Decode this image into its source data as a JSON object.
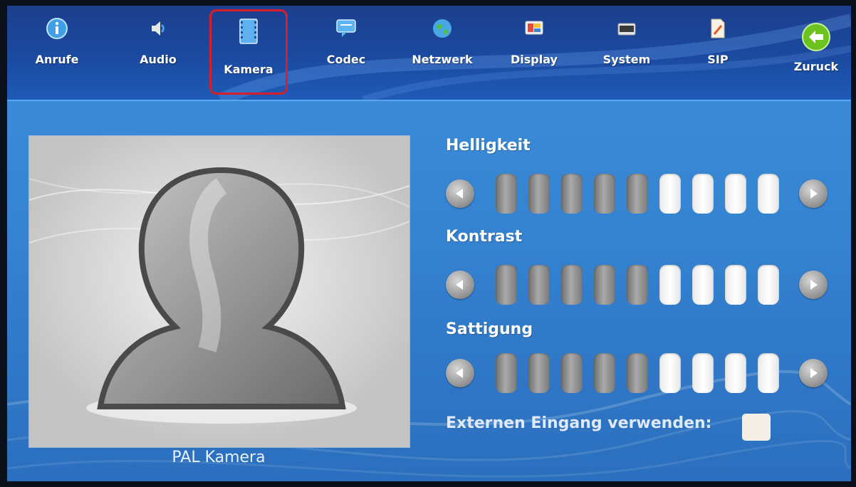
{
  "nav": {
    "items": [
      {
        "label": "Anrufe",
        "icon": "info-icon"
      },
      {
        "label": "Audio",
        "icon": "speaker-icon"
      },
      {
        "label": "Kamera",
        "icon": "film-icon",
        "active": true
      },
      {
        "label": "Codec",
        "icon": "chat-bubble-icon"
      },
      {
        "label": "Netzwerk",
        "icon": "globe-icon"
      },
      {
        "label": "Display",
        "icon": "display-icon"
      },
      {
        "label": "System",
        "icon": "folder-icon"
      },
      {
        "label": "SIP",
        "icon": "document-icon"
      },
      {
        "label": "Zuruck",
        "icon": "back-arrow-icon"
      }
    ]
  },
  "preview": {
    "caption": "PAL Kamera",
    "icon": "user-silhouette-icon"
  },
  "settings": [
    {
      "label": "Helligkeit",
      "level": 5,
      "max": 9
    },
    {
      "label": "Kontrast",
      "level": 5,
      "max": 9
    },
    {
      "label": "Sattigung",
      "level": 5,
      "max": 9
    }
  ],
  "external_input": {
    "label": "Externen Eingang verwenden:",
    "checked": false
  },
  "colors": {
    "background": "#3584d2",
    "topbar": "#1b4aa0",
    "active_outline": "#d61f2b"
  }
}
